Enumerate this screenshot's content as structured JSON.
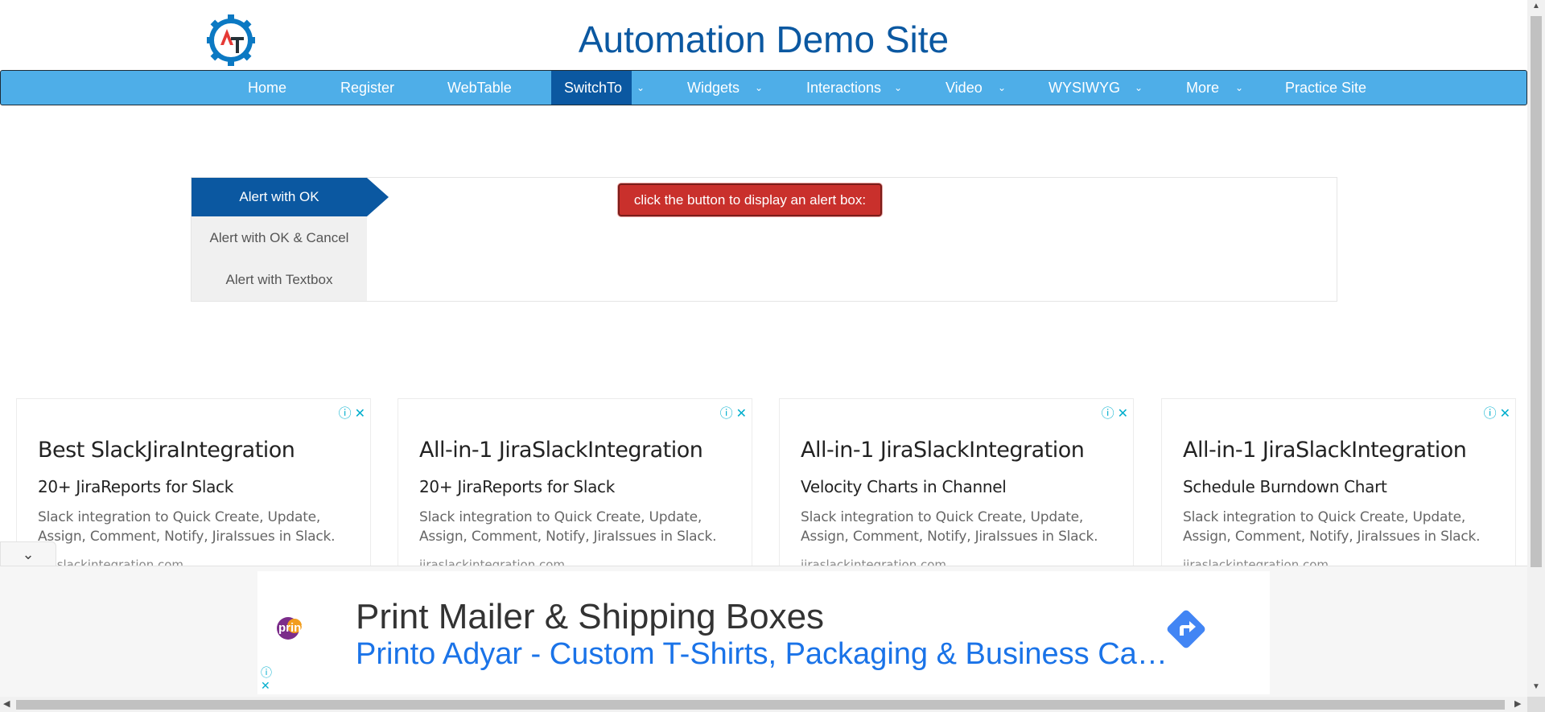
{
  "header": {
    "logo_icon": "gear-logo-icon",
    "site_title": "Automation Demo Site"
  },
  "nav": {
    "items": [
      {
        "label": "Home",
        "has_dropdown": false,
        "active": false
      },
      {
        "label": "Register",
        "has_dropdown": false,
        "active": false
      },
      {
        "label": "WebTable",
        "has_dropdown": false,
        "active": false
      },
      {
        "label": "SwitchTo",
        "has_dropdown": true,
        "active": true
      },
      {
        "label": "Widgets",
        "has_dropdown": true,
        "active": false
      },
      {
        "label": "Interactions",
        "has_dropdown": true,
        "active": false
      },
      {
        "label": "Video",
        "has_dropdown": true,
        "active": false
      },
      {
        "label": "WYSIWYG",
        "has_dropdown": true,
        "active": false
      },
      {
        "label": "More",
        "has_dropdown": true,
        "active": false
      },
      {
        "label": "Practice Site",
        "has_dropdown": false,
        "active": false
      }
    ],
    "dropdown_icon": "chevron-down-icon"
  },
  "alerts": {
    "tabs": [
      {
        "label": "Alert with OK",
        "active": true
      },
      {
        "label": "Alert with OK & Cancel",
        "active": false
      },
      {
        "label": "Alert with Textbox",
        "active": false
      }
    ],
    "button_label": "click the button to display an alert box:"
  },
  "ads": [
    {
      "title": "Best SlackJiraIntegration",
      "subtitle": "20+ JiraReports for Slack",
      "body": "Slack integration to Quick Create, Update, Assign, Comment, Notify, JiraIssues in Slack.",
      "domain": "jiraslackintegration.com"
    },
    {
      "title": "All-in-1 JiraSlackIntegration",
      "subtitle": "20+ JiraReports for Slack",
      "body": "Slack integration to Quick Create, Update, Assign, Comment, Notify, JiraIssues in Slack.",
      "domain": "jiraslackintegration.com"
    },
    {
      "title": "All-in-1 JiraSlackIntegration",
      "subtitle": "Velocity Charts in Channel",
      "body": "Slack integration to Quick Create, Update, Assign, Comment, Notify, JiraIssues in Slack.",
      "domain": "jiraslackintegration.com"
    },
    {
      "title": "All-in-1 JiraSlackIntegration",
      "subtitle": "Schedule Burndown Chart",
      "body": "Slack integration to Quick Create, Update, Assign, Comment, Notify, JiraIssues in Slack.",
      "domain": "jiraslackintegration.com"
    }
  ],
  "ad_icons": {
    "info": "ⓘ",
    "close": "✕"
  },
  "banner": {
    "brand": "printo",
    "title": "Print Mailer & Shipping Boxes",
    "link": "Printo Adyar - Custom T-Shirts, Packaging & Business Ca…",
    "collapse_icon": "⌄"
  },
  "colors": {
    "brand_blue": "#0b58a1",
    "nav_blue": "#4eaee8",
    "alert_red": "#c9302c",
    "ad_icon_teal": "#00aecd",
    "link_blue": "#1a73e8"
  }
}
